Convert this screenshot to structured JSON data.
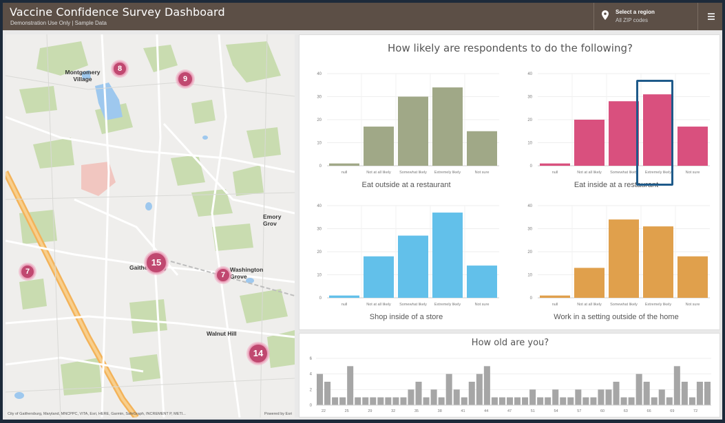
{
  "header": {
    "title": "Vaccine Confidence Survey Dashboard",
    "subtitle": "Demonstration Use Only | Sample Data",
    "region_label": "Select a region",
    "region_value": "All ZIP codes"
  },
  "map": {
    "labels": [
      {
        "text": "Montgomery Village",
        "name": "montgomery-village"
      },
      {
        "text": "Gaithersburg",
        "name": "gaithersburg"
      },
      {
        "text": "Washington Grove",
        "name": "washington-grove"
      },
      {
        "text": "Walnut Hill",
        "name": "walnut-hill"
      },
      {
        "text": "Emory Grov",
        "name": "emory-grove"
      }
    ],
    "clusters": [
      {
        "count": "8",
        "name": "cluster-8"
      },
      {
        "count": "9",
        "name": "cluster-9"
      },
      {
        "count": "15",
        "name": "cluster-15"
      },
      {
        "count": "7",
        "name": "cluster-7-west"
      },
      {
        "count": "7",
        "name": "cluster-7-washington-grove"
      },
      {
        "count": "14",
        "name": "cluster-14"
      }
    ],
    "attribution": "City of Gaithersburg, Maryland, MNCPPC, VITA, Esri, HERE, Garmin, SafeGraph, INCREMENT P, METI...",
    "powered_by": "Powered by Esri"
  },
  "charts_panel": {
    "title": "How likely are respondents to do the following?"
  },
  "chart_data": [
    {
      "type": "bar",
      "title": "Eat outside at a restaurant",
      "categories": [
        "null",
        "Not at all likely",
        "Somewhat likely",
        "Extremely likely",
        "Not sure"
      ],
      "values": [
        1,
        17,
        30,
        34,
        15
      ],
      "ylim": [
        0,
        40
      ],
      "yticks": [
        "40",
        "30",
        "20",
        "10",
        "0"
      ],
      "color": "#a0a887"
    },
    {
      "type": "bar",
      "title": "Eat inside at a restaurant",
      "categories": [
        "null",
        "Not at all likely",
        "Somewhat likely",
        "Extremely likely",
        "Not sure"
      ],
      "values": [
        1,
        20,
        28,
        31,
        17
      ],
      "ylim": [
        0,
        40
      ],
      "yticks": [
        "40",
        "30",
        "20",
        "10",
        "0"
      ],
      "color": "#d9507e"
    },
    {
      "type": "bar",
      "title": "Shop inside of a store",
      "categories": [
        "null",
        "Not at all likely",
        "Somewhat likely",
        "Extremely likely",
        "Not sure"
      ],
      "values": [
        1,
        18,
        27,
        37,
        14
      ],
      "ylim": [
        0,
        40
      ],
      "yticks": [
        "40",
        "30",
        "20",
        "10",
        "0"
      ],
      "color": "#62c0ea"
    },
    {
      "type": "bar",
      "title": "Work in a setting outside of the home",
      "categories": [
        "null",
        "Not at all likely",
        "Somewhat likely",
        "Extremely likely",
        "Not sure"
      ],
      "values": [
        1,
        13,
        34,
        31,
        18
      ],
      "ylim": [
        0,
        40
      ],
      "yticks": [
        "40",
        "30",
        "20",
        "10",
        "0"
      ],
      "color": "#e0a04c"
    },
    {
      "type": "bar",
      "title": "How old are you?",
      "values": [
        4,
        3,
        1,
        1,
        5,
        1,
        1,
        1,
        1,
        1,
        1,
        1,
        2,
        3,
        1,
        2,
        1,
        4,
        2,
        1,
        3,
        4,
        5,
        1,
        1,
        1,
        1,
        1,
        2,
        1,
        1,
        2,
        1,
        1,
        2,
        1,
        1,
        2,
        2,
        3,
        1,
        1,
        4,
        3,
        1,
        2,
        1,
        5,
        3,
        1,
        3,
        3
      ],
      "xticks": [
        "22",
        "25",
        "29",
        "32",
        "35",
        "38",
        "41",
        "44",
        "47",
        "51",
        "54",
        "57",
        "60",
        "63",
        "66",
        "69",
        "72"
      ],
      "ylim": [
        0,
        6
      ],
      "yticks": [
        "6",
        "4",
        "2",
        "0"
      ],
      "color": "#a6a6a6"
    }
  ],
  "colors": {
    "header": "#5c4f46",
    "highlight": "#1e5a8a"
  }
}
